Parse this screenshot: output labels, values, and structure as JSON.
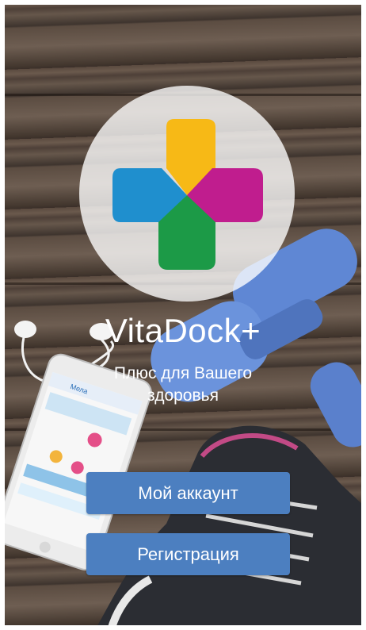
{
  "app": {
    "title": "VitaDock+",
    "tagline": "Плюс для Вашего здоровья"
  },
  "actions": {
    "account_label": "Мой аккаунт",
    "register_label": "Регистрация"
  },
  "phone_mockup": {
    "brand": "Мела"
  },
  "colors": {
    "button": "#4c7fc0",
    "logo_yellow": "#f7b916",
    "logo_blue": "#1f8fce",
    "logo_magenta": "#c01d8e",
    "logo_green": "#1c9a47"
  },
  "icons": {
    "logo": "plus-cross-logo",
    "decor": [
      "dumbbell",
      "sneaker",
      "earphones",
      "smartphone"
    ]
  }
}
